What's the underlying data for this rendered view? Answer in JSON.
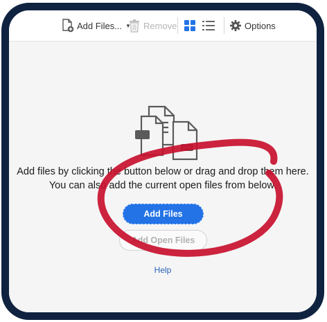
{
  "toolbar": {
    "add_files_label": "Add Files...",
    "remove_label": "Remove",
    "options_label": "Options"
  },
  "main": {
    "instruction_line1": "Add files by clicking the button below or drag and drop them here.",
    "instruction_line2": "You can also add the current open files from below.",
    "add_files_button": "Add Files",
    "add_open_files_button": "Add Open Files",
    "help_link": "Help"
  },
  "colors": {
    "frame": "#0f2340",
    "primary_button": "#2373e6",
    "annotation_circle": "#c8102e",
    "grid_view_active": "#2373e6"
  },
  "icons": [
    "add-files-icon",
    "trash-icon",
    "grid-view-icon",
    "list-view-icon",
    "gear-icon",
    "documents-illustration-icon"
  ]
}
